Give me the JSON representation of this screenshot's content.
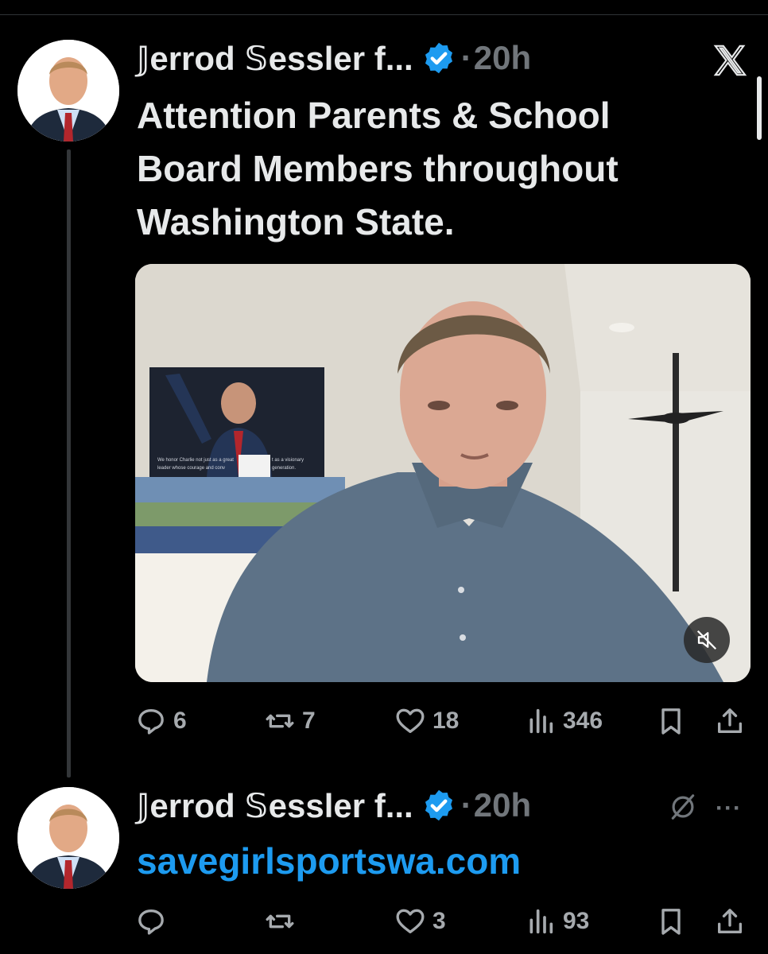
{
  "tweets": [
    {
      "author": "𝕁errod 𝕊essler f...",
      "separator": "·",
      "time": "20h",
      "text": "Attention Parents & School Board Members throughout Washington State.",
      "media_overlay": [
        "We honor Charlie not just as a great",
        "leader whose courage and conv",
        "t as a visionary",
        "generation."
      ],
      "actions": {
        "replies": "6",
        "reposts": "7",
        "likes": "18",
        "views": "346"
      }
    },
    {
      "author": "𝕁errod 𝕊essler f...",
      "separator": "·",
      "time": "20h",
      "text": "savegirlsportswa.com",
      "actions": {
        "replies": "",
        "reposts": "",
        "likes": "3",
        "views": "93"
      }
    }
  ],
  "more_label": "···",
  "icons": [
    "verified-badge-icon",
    "x-logo-icon",
    "reply-icon",
    "repost-icon",
    "like-icon",
    "views-icon",
    "bookmark-icon",
    "share-icon",
    "mute-icon",
    "grok-icon",
    "more-icon"
  ],
  "colors": {
    "background": "#000000",
    "text": "#e7e9ea",
    "muted": "#71767b",
    "link": "#1d9bf0",
    "badge": "#1d9bf0"
  }
}
